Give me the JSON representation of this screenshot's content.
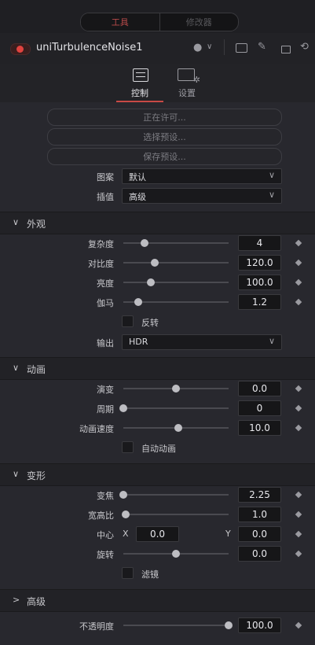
{
  "top_tabs": {
    "tools": "工具",
    "modifiers": "修改器"
  },
  "node": {
    "title": "uniTurbulenceNoise1"
  },
  "inspector_tabs": [
    {
      "label": "控制"
    },
    {
      "label": "设置"
    }
  ],
  "buttons": {
    "license": "正在许可...",
    "select_preset": "选择预设...",
    "save_preset": "保存预设..."
  },
  "pattern": {
    "label": "图案",
    "value": "默认"
  },
  "interpolation": {
    "label": "插值",
    "value": "高级"
  },
  "appearance": {
    "title": "外观",
    "complexity": {
      "label": "复杂度",
      "value": "4",
      "level": 0.2
    },
    "contrast": {
      "label": "对比度",
      "value": "120.0",
      "level": 0.3
    },
    "brightness": {
      "label": "亮度",
      "value": "100.0",
      "level": 0.26
    },
    "gamma": {
      "label": "伽马",
      "value": "1.2",
      "level": 0.14
    },
    "invert": {
      "label": "反转",
      "checked": false
    },
    "output": {
      "label": "输出",
      "value": "HDR"
    }
  },
  "animation": {
    "title": "动画",
    "evolution": {
      "label": "演变",
      "value": "0.0",
      "level": 0.5
    },
    "cycle": {
      "label": "周期",
      "value": "0",
      "level": 0.0
    },
    "speed": {
      "label": "动画速度",
      "value": "10.0",
      "level": 0.52
    },
    "auto": {
      "label": "自动动画",
      "checked": false
    }
  },
  "transform": {
    "title": "变形",
    "zoom": {
      "label": "变焦",
      "value": "2.25",
      "level": 0.0
    },
    "aspect": {
      "label": "宽高比",
      "value": "1.0",
      "level": 0.02
    },
    "center": {
      "label": "中心",
      "x_label": "X",
      "x": "0.0",
      "y_label": "Y",
      "y": "0.0"
    },
    "rotation": {
      "label": "旋转",
      "value": "0.0",
      "level": 0.5
    },
    "filter": {
      "label": "滤镜",
      "checked": false
    }
  },
  "advanced": {
    "title": "高级"
  },
  "opacity": {
    "label": "不透明度",
    "value": "100.0",
    "level": 1.0
  }
}
